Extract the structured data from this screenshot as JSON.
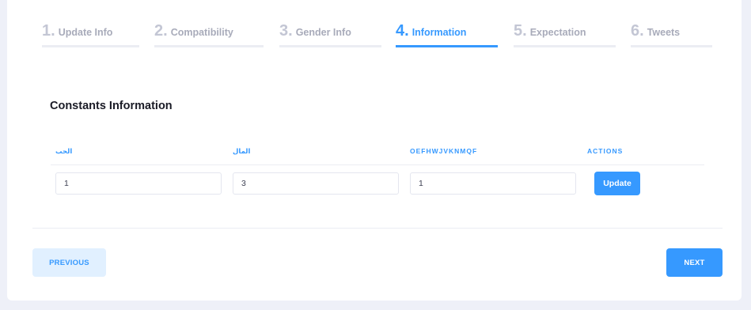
{
  "wizard": {
    "steps": [
      {
        "num": "1.",
        "label": "Update Info",
        "active": false
      },
      {
        "num": "2.",
        "label": "Compatibility",
        "active": false
      },
      {
        "num": "3.",
        "label": "Gender Info",
        "active": false
      },
      {
        "num": "4.",
        "label": "Information",
        "active": true
      },
      {
        "num": "5.",
        "label": "Expectation",
        "active": false
      },
      {
        "num": "6.",
        "label": "Tweets",
        "active": false
      }
    ]
  },
  "section": {
    "title": "Constants Information"
  },
  "table": {
    "headers": [
      "الحب",
      "المال",
      "OEFHWJVKNMQF",
      "ACTIONS"
    ],
    "row": {
      "values": [
        "1",
        "3",
        "1"
      ],
      "action_label": "Update"
    }
  },
  "footer": {
    "previous_label": "PREVIOUS",
    "next_label": "NEXT"
  },
  "colors": {
    "accent": "#3699ff",
    "inactive_step": "#a8abba",
    "page_bg": "#eef0f8"
  }
}
